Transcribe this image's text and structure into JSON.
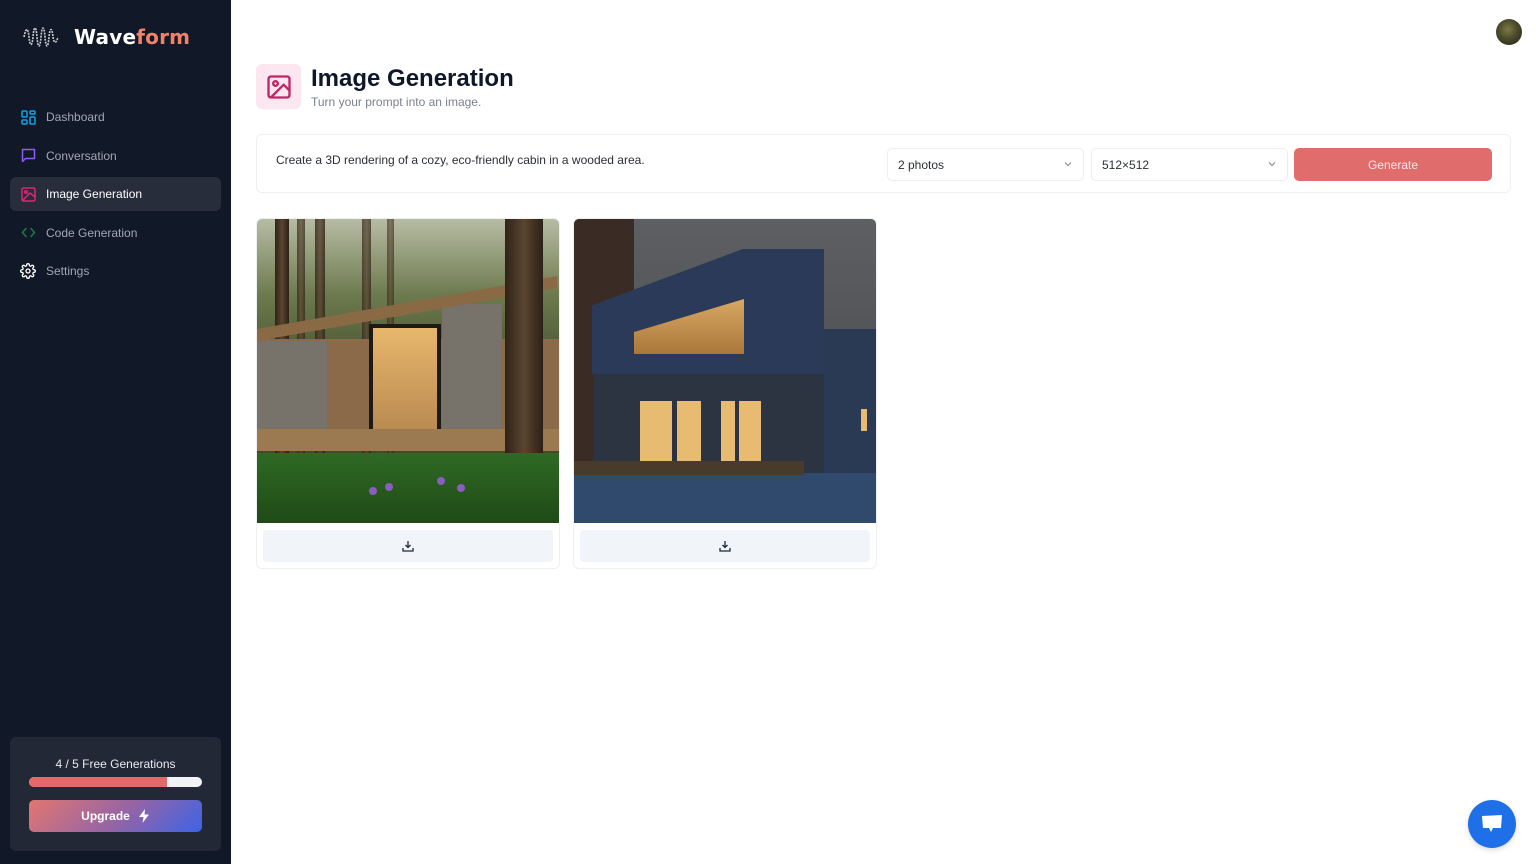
{
  "app": {
    "name_primary": "Wave",
    "name_accent": "form"
  },
  "sidebar": {
    "items": [
      {
        "label": "Dashboard",
        "icon": "dashboard-grid-icon",
        "color": "#0ea5e9",
        "active": false
      },
      {
        "label": "Conversation",
        "icon": "message-square-icon",
        "color": "#8b5cf6",
        "active": false
      },
      {
        "label": "Image Generation",
        "icon": "image-icon",
        "color": "#db2777",
        "active": true
      },
      {
        "label": "Code Generation",
        "icon": "code-icon",
        "color": "#15803d",
        "active": false
      },
      {
        "label": "Settings",
        "icon": "settings-gear-icon",
        "color": "#ffffff",
        "active": false
      }
    ],
    "usage": {
      "label": "4 / 5 Free Generations",
      "used": 4,
      "limit": 5,
      "progress_fraction": 0.8
    },
    "upgrade_label": "Upgrade"
  },
  "header": {
    "title": "Image Generation",
    "subtitle": "Turn your prompt into an image."
  },
  "form": {
    "prompt_value": "Create a 3D rendering of a cozy, eco-friendly cabin in a wooded area.",
    "amount_selected": "2 photos",
    "resolution_selected": "512×512",
    "generate_label": "Generate"
  },
  "gallery": {
    "images": [
      {
        "description": "Cozy wooden cabin among tall pine trees with green grass",
        "download_icon": "download-icon"
      },
      {
        "description": "Modern dark blue house at dusk with lit windows",
        "download_icon": "download-icon"
      }
    ]
  },
  "colors": {
    "sidebar_bg": "#111827",
    "accent_red": "#e06c6c",
    "brand_accent": "#f0826a",
    "chat_button": "#1f6fe8"
  }
}
